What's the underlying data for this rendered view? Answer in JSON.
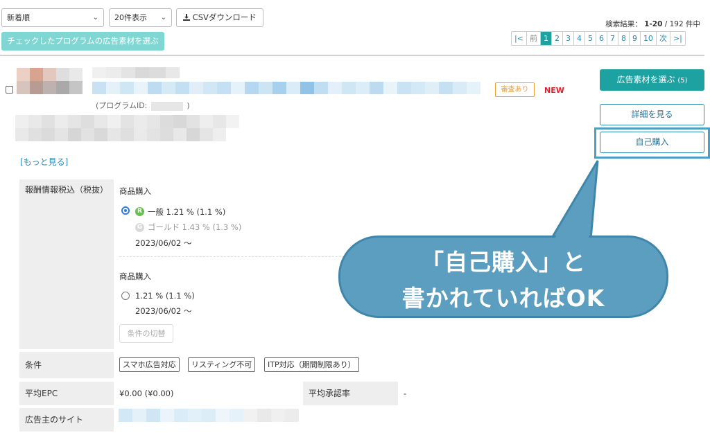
{
  "toolbar": {
    "sort_value": "新着順",
    "per_page_value": "20件表示",
    "csv_button": "CSVダウンロード",
    "choose_checked_button": "チェックしたプログラムの広告素材を選ぶ"
  },
  "results": {
    "label": "検索結果：",
    "range": "1-20",
    "total": "/ 192 件中"
  },
  "pagination": {
    "first": "|<",
    "prev": "前",
    "pages": [
      "1",
      "2",
      "3",
      "4",
      "5",
      "6",
      "7",
      "8",
      "9",
      "10"
    ],
    "current": "1",
    "next": "次",
    "last": ">|"
  },
  "program": {
    "id_label": "(プログラムID:",
    "id_close": ")",
    "review_badge": "審査あり",
    "new_badge": "NEW",
    "more_link": "[もっと見る]"
  },
  "actions": {
    "choose_materials": "広告素材を選ぶ",
    "choose_materials_count": "(5)",
    "details": "詳細を見る",
    "self_purchase": "自己購入"
  },
  "reward": {
    "header": "報酬情報税込（税抜）",
    "section1_title": "商品購入",
    "rank_r_icon": "R",
    "rank_r_text": "一般 1.21 % (1.1 %)",
    "rank_g_icon": "G",
    "rank_g_text": "ゴールド 1.43 % (1.3 %)",
    "date1": "2023/06/02 ～",
    "section2_title": "商品購入",
    "option2_text": "1.21 % (1.1 %)",
    "date2": "2023/06/02 ～",
    "switch_button": "条件の切替"
  },
  "conditions": {
    "header": "条件",
    "tags": [
      "スマホ広告対応",
      "リスティング不可",
      "ITP対応（期間制限あり）"
    ]
  },
  "epc": {
    "header": "平均EPC",
    "value": "¥0.00 (¥0.00)",
    "approval_header": "平均承認率",
    "approval_value": "-"
  },
  "advertiser": {
    "header": "広告主のサイト"
  },
  "callout": {
    "line1": "「自己購入」と",
    "line2": "書かれていればOK"
  },
  "colors": {
    "teal": "#1ea1a1",
    "callout": "#5b9ec0",
    "link": "#2a89b4",
    "new": "#e0202a",
    "review": "#f39c2a"
  }
}
